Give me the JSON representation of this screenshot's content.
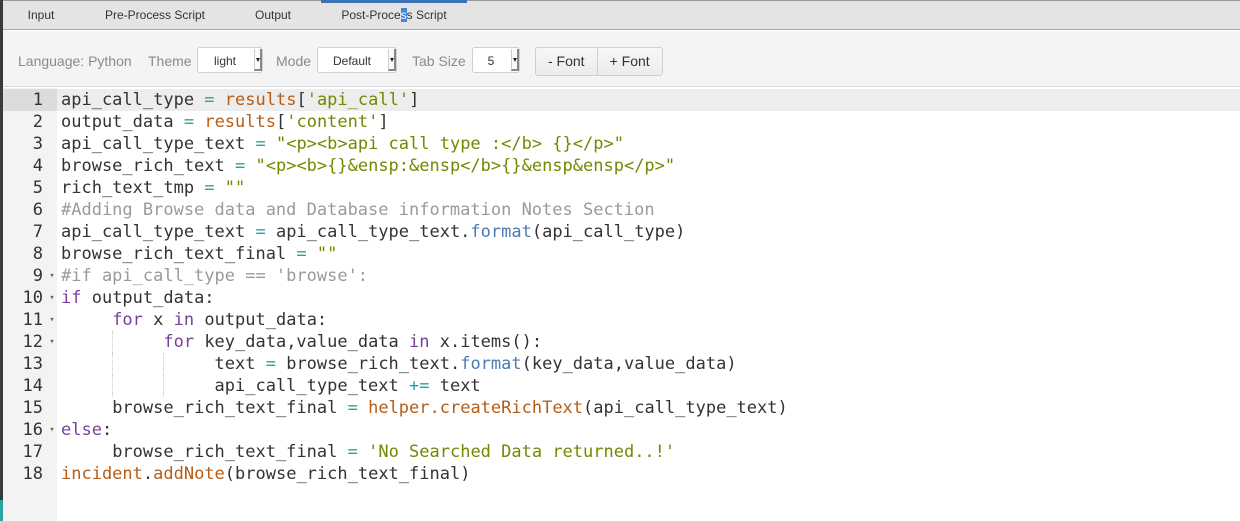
{
  "tabs": [
    {
      "label": "Input",
      "active": false
    },
    {
      "label": "Pre-Process Script",
      "active": false
    },
    {
      "label": "Output",
      "active": false
    },
    {
      "label": "Post-Process Script",
      "active": true
    }
  ],
  "active_tab_selection": {
    "before": "Post-Proce",
    "selected": "s",
    "after": "s Script"
  },
  "toolbar": {
    "language_label": "Language: Python",
    "theme_label": "Theme",
    "theme_value": "light",
    "mode_label": "Mode",
    "mode_value": "Default",
    "tab_size_label": "Tab Size",
    "tab_size_value": "5",
    "font_decrease_label": "- Font",
    "font_increase_label": "+ Font"
  },
  "editor": {
    "active_line": 1,
    "lines": [
      {
        "n": "1",
        "fold": false,
        "indent": 0,
        "tokens": [
          [
            "",
            "api_call_type "
          ],
          [
            "op",
            "="
          ],
          [
            "",
            " "
          ],
          [
            "obj",
            "results"
          ],
          [
            "",
            "["
          ],
          [
            "str",
            "'api_call'"
          ],
          [
            "",
            "]"
          ]
        ]
      },
      {
        "n": "2",
        "fold": false,
        "indent": 0,
        "tokens": [
          [
            "",
            "output_data "
          ],
          [
            "op",
            "="
          ],
          [
            "",
            " "
          ],
          [
            "obj",
            "results"
          ],
          [
            "",
            "["
          ],
          [
            "str",
            "'content'"
          ],
          [
            "",
            "]"
          ]
        ]
      },
      {
        "n": "3",
        "fold": false,
        "indent": 0,
        "tokens": [
          [
            "",
            "api_call_type_text "
          ],
          [
            "op",
            "="
          ],
          [
            "",
            " "
          ],
          [
            "str",
            "\"<p><b>api call type :</b> {}</p>\""
          ]
        ]
      },
      {
        "n": "4",
        "fold": false,
        "indent": 0,
        "tokens": [
          [
            "",
            "browse_rich_text "
          ],
          [
            "op",
            "="
          ],
          [
            "",
            " "
          ],
          [
            "str",
            "\"<p><b>{}&ensp:&ensp</b>{}&ensp&ensp</p>\""
          ]
        ]
      },
      {
        "n": "5",
        "fold": false,
        "indent": 0,
        "tokens": [
          [
            "",
            "rich_text_tmp "
          ],
          [
            "op",
            "="
          ],
          [
            "",
            " "
          ],
          [
            "str",
            "\"\""
          ]
        ]
      },
      {
        "n": "6",
        "fold": false,
        "indent": 0,
        "tokens": [
          [
            "cmt",
            "#Adding Browse data and Database information Notes Section"
          ]
        ]
      },
      {
        "n": "7",
        "fold": false,
        "indent": 0,
        "tokens": [
          [
            "",
            "api_call_type_text "
          ],
          [
            "op",
            "="
          ],
          [
            "",
            " api_call_type_text."
          ],
          [
            "meth",
            "format"
          ],
          [
            "",
            "(api_call_type)"
          ]
        ]
      },
      {
        "n": "8",
        "fold": false,
        "indent": 0,
        "tokens": [
          [
            "",
            "browse_rich_text_final "
          ],
          [
            "op",
            "="
          ],
          [
            "",
            " "
          ],
          [
            "str",
            "\"\""
          ]
        ]
      },
      {
        "n": "9",
        "fold": true,
        "indent": 0,
        "tokens": [
          [
            "cmt",
            "#if api_call_type == 'browse':"
          ]
        ]
      },
      {
        "n": "10",
        "fold": true,
        "indent": 0,
        "tokens": [
          [
            "kw",
            "if"
          ],
          [
            "",
            " output_data:"
          ]
        ]
      },
      {
        "n": "11",
        "fold": true,
        "indent": 1,
        "tokens": [
          [
            "kw",
            "for"
          ],
          [
            "",
            " x "
          ],
          [
            "kw",
            "in"
          ],
          [
            "",
            " output_data:"
          ]
        ]
      },
      {
        "n": "12",
        "fold": true,
        "indent": 2,
        "tokens": [
          [
            "kw",
            "for"
          ],
          [
            "",
            " key_data,value_data "
          ],
          [
            "kw",
            "in"
          ],
          [
            "",
            " x.items():"
          ]
        ]
      },
      {
        "n": "13",
        "fold": false,
        "indent": 3,
        "tokens": [
          [
            "",
            "text "
          ],
          [
            "op",
            "="
          ],
          [
            "",
            " browse_rich_text."
          ],
          [
            "meth",
            "format"
          ],
          [
            "",
            "(key_data,value_data)"
          ]
        ]
      },
      {
        "n": "14",
        "fold": false,
        "indent": 3,
        "tokens": [
          [
            "",
            "api_call_type_text "
          ],
          [
            "op",
            "+="
          ],
          [
            "",
            " text"
          ]
        ]
      },
      {
        "n": "15",
        "fold": false,
        "indent": 1,
        "tokens": [
          [
            "",
            "browse_rich_text_final "
          ],
          [
            "op",
            "="
          ],
          [
            "",
            " "
          ],
          [
            "hfn",
            "helper.createRichText"
          ],
          [
            "",
            "(api_call_type_text)"
          ]
        ]
      },
      {
        "n": "16",
        "fold": true,
        "indent": 0,
        "tokens": [
          [
            "kw",
            "else"
          ],
          [
            "",
            ":"
          ]
        ]
      },
      {
        "n": "17",
        "fold": false,
        "indent": 1,
        "tokens": [
          [
            "",
            "browse_rich_text_final "
          ],
          [
            "op",
            "="
          ],
          [
            "",
            " "
          ],
          [
            "str",
            "'No Searched Data returned..!'"
          ]
        ]
      },
      {
        "n": "18",
        "fold": false,
        "indent": 0,
        "tokens": [
          [
            "obj",
            "incident"
          ],
          [
            "",
            "."
          ],
          [
            "hfn",
            "addNote"
          ],
          [
            "",
            "(browse_rich_text_final)"
          ]
        ]
      }
    ]
  }
}
